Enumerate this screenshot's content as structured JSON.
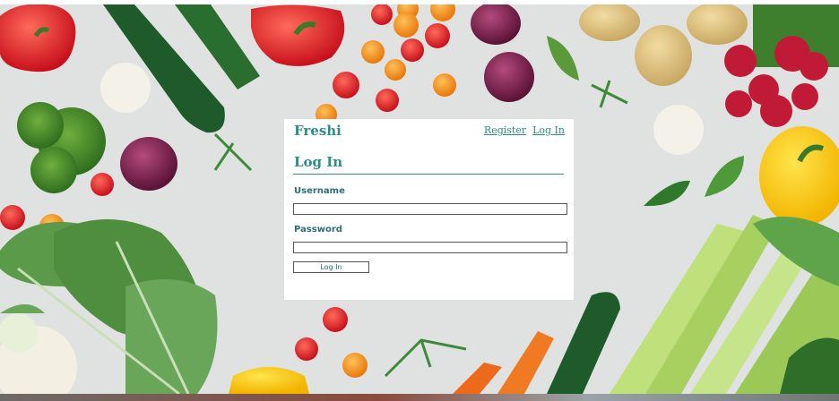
{
  "site": {
    "brand": "Freshi"
  },
  "nav": {
    "register": "Register",
    "login": "Log In"
  },
  "form": {
    "heading": "Log In",
    "username_label": "Username",
    "username_value": "",
    "password_label": "Password",
    "password_value": "",
    "submit_label": "Log In"
  },
  "colors": {
    "accent": "#2d8c8c",
    "panel": "#ffffff",
    "background": "#dfe2e1"
  }
}
